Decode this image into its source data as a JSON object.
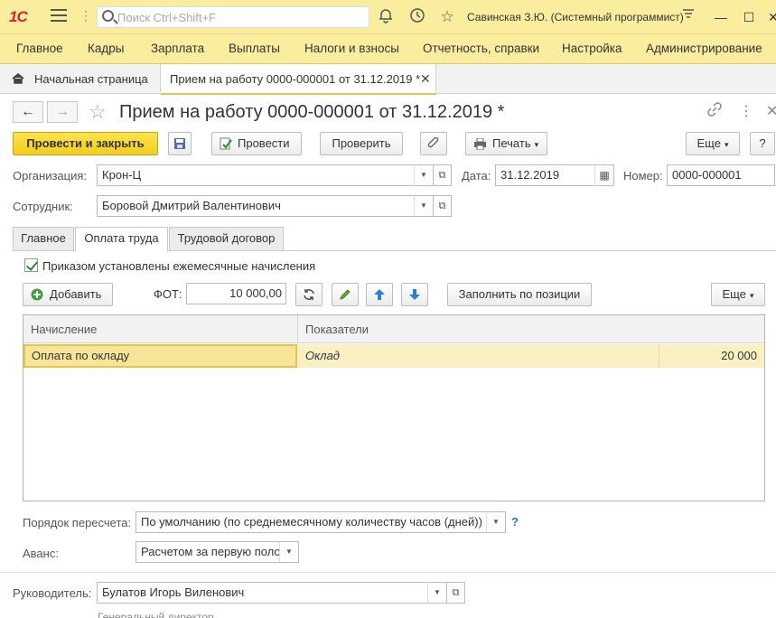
{
  "topbar": {
    "logo": "1С",
    "search_placeholder": "Поиск Ctrl+Shift+F",
    "user": "Савинская З.Ю. (Системный программист)"
  },
  "menu": [
    "Главное",
    "Кадры",
    "Зарплата",
    "Выплаты",
    "Налоги и взносы",
    "Отчетность, справки",
    "Настройка",
    "Администрирование"
  ],
  "tabs": {
    "home": "Начальная страница",
    "doc": "Прием на работу 0000-000001 от 31.12.2019 *"
  },
  "doc": {
    "title": "Прием на работу 0000-000001 от 31.12.2019 *"
  },
  "toolbar": {
    "post_close": "Провести и закрыть",
    "post": "Провести",
    "check": "Проверить",
    "print": "Печать",
    "more": "Еще",
    "help": "?"
  },
  "fields": {
    "org_label": "Организация:",
    "org_value": "Крон-Ц",
    "date_label": "Дата:",
    "date_value": "31.12.2019",
    "num_label": "Номер:",
    "num_value": "0000-000001",
    "emp_label": "Сотрудник:",
    "emp_value": "Боровой Дмитрий Валентинович"
  },
  "form_tabs": [
    "Главное",
    "Оплата труда",
    "Трудовой договор"
  ],
  "pay": {
    "checkbox_label": "Приказом установлены ежемесячные начисления",
    "add_label": "Добавить",
    "fot_label": "ФОТ:",
    "fot_value": "10 000,00",
    "fill_label": "Заполнить по позиции",
    "more_label": "Еще"
  },
  "grid": {
    "columns": [
      "Начисление",
      "Показатели"
    ],
    "rows": [
      {
        "accrual": "Оплата по окладу",
        "indicator": "Оклад",
        "value": "20 000"
      }
    ]
  },
  "bottom": {
    "recalc_label": "Порядок пересчета:",
    "recalc_value": "По умолчанию (по среднемесячному количеству часов (дней))",
    "help": "?",
    "advance_label": "Аванс:",
    "advance_value": "Расчетом за первую полс",
    "head_label": "Руководитель:",
    "head_value": "Булатов Игорь Виленович",
    "head_position": "Генеральный директор"
  }
}
